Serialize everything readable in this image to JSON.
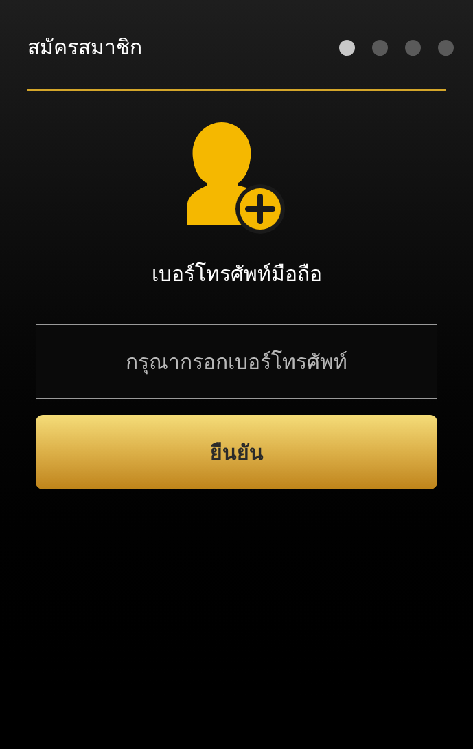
{
  "header": {
    "title": "สมัครสมาชิก"
  },
  "steps": [
    {
      "selected": true
    },
    {
      "selected": false
    },
    {
      "selected": false
    },
    {
      "selected": false
    }
  ],
  "form": {
    "heading": "เบอร์โทรศัพท์มือถือ",
    "phone": {
      "placeholder": "กรุณากรอกเบอร์โทรศัพท์"
    },
    "submit": "ยืนยัน"
  }
}
